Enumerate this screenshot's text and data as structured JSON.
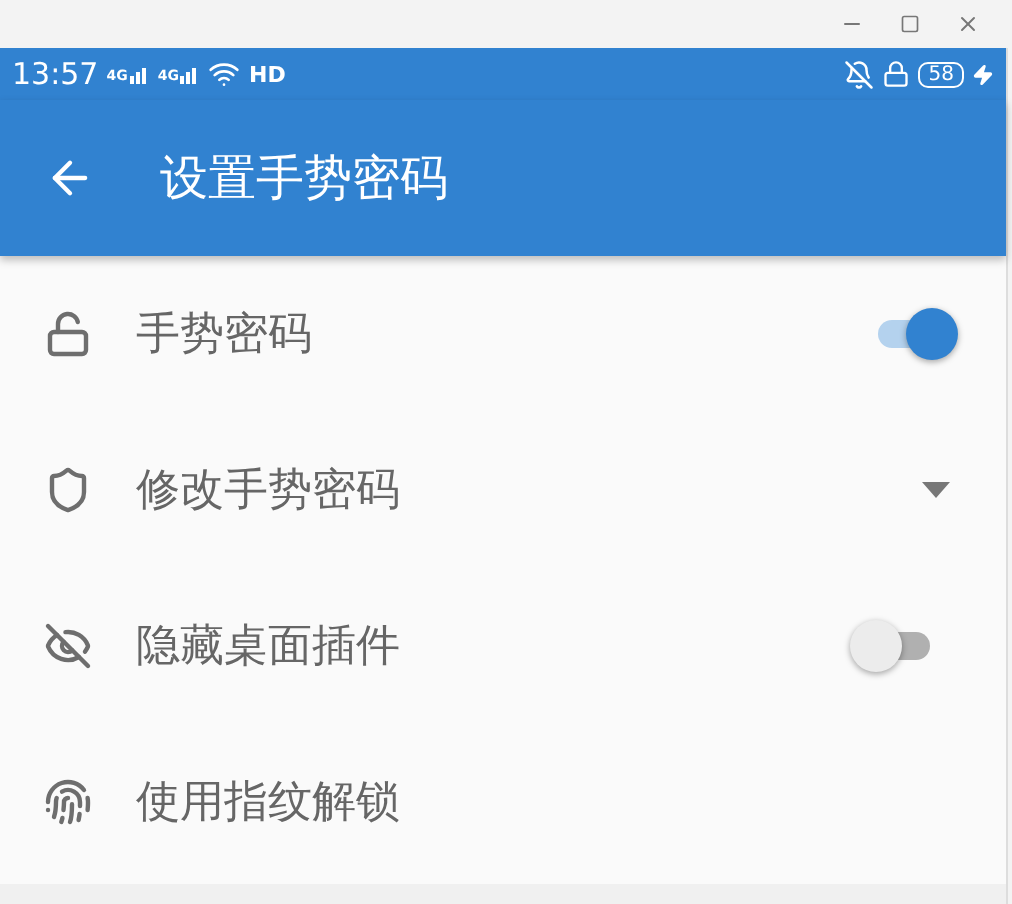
{
  "status_bar": {
    "time": "13:57",
    "networks": [
      "4G",
      "4G"
    ],
    "hd": "HD",
    "battery": "58"
  },
  "app_bar": {
    "title": "设置手势密码"
  },
  "settings": [
    {
      "kind": "toggle",
      "label": "手势密码",
      "on": true
    },
    {
      "kind": "dropdown",
      "label": "修改手势密码"
    },
    {
      "kind": "toggle",
      "label": "隐藏桌面插件",
      "on": false
    },
    {
      "kind": "plain",
      "label": "使用指纹解锁"
    }
  ]
}
